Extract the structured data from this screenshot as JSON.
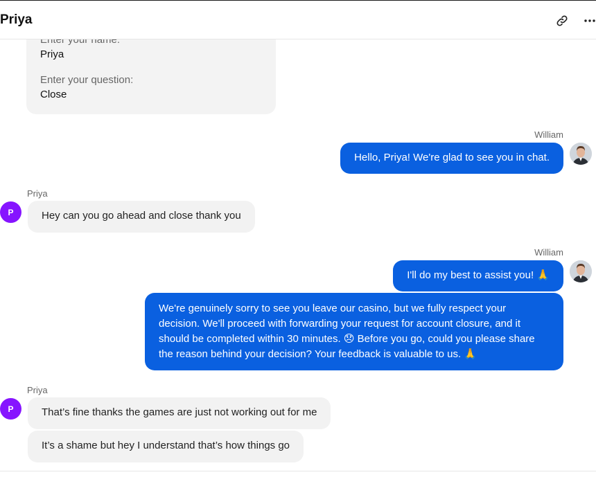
{
  "header": {
    "title": "Priya",
    "link_icon": "link-icon",
    "more_icon": "more-horizontal-icon"
  },
  "form": {
    "name_label": "Enter your name:",
    "name_value": "Priya",
    "question_label": "Enter your question:",
    "question_value": "Close"
  },
  "messages": {
    "m1": {
      "sender": "William",
      "text": "Hello, Priya! We're glad to see you in chat."
    },
    "m2": {
      "sender": "Priya",
      "avatar_letter": "P",
      "text": "Hey can you go ahead and close thank you"
    },
    "m3": {
      "sender": "William",
      "text": "I'll do my best to assist you! 🙏"
    },
    "m4": {
      "text": "We're genuinely sorry to see you leave our casino, but we fully respect your decision. We'll proceed with forwarding your request for account closure, and it should be completed within 30 minutes. 😞 Before you go, could you please share the reason behind your decision? Your feedback is valuable to us. 🙏"
    },
    "m5": {
      "sender": "Priya",
      "avatar_letter": "P",
      "text": "That’s fine thanks the games are just not working out for me"
    },
    "m6": {
      "text": "It’s a shame but hey I understand that’s how things go"
    }
  },
  "colors": {
    "agent_bubble": "#0a60e0",
    "user_bubble": "#f2f2f2",
    "user_avatar": "#8614ff"
  }
}
